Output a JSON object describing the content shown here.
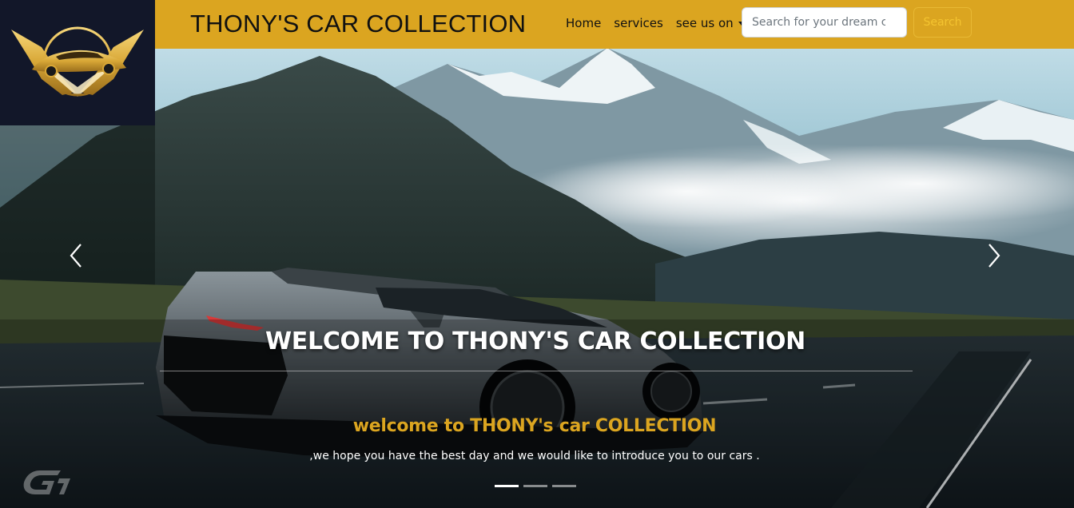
{
  "navbar": {
    "brand": "THONY'S CAR COLLECTION",
    "links": [
      {
        "label": "Home"
      },
      {
        "label": "services"
      },
      {
        "label": "see us on"
      }
    ],
    "search_placeholder": "Search for your dream c",
    "search_button": "Search"
  },
  "hero": {
    "title": "WELCOME TO THONY'S CAR COLLECTION",
    "subtitle": "welcome to THONY's car COLLECTION",
    "text": ",we hope you have the best day and we would like to introduce you to our cars .",
    "slides_total": 3,
    "active_slide": 1
  },
  "icons": {
    "logo": "car-emblem-logo",
    "prev": "chevron-left-icon",
    "next": "chevron-right-icon",
    "dropdown": "caret-down-icon",
    "watermark": "gt-logo"
  },
  "colors": {
    "accent": "#dba520",
    "logo_bg": "#121729",
    "caption_highlight": "#dba520"
  }
}
